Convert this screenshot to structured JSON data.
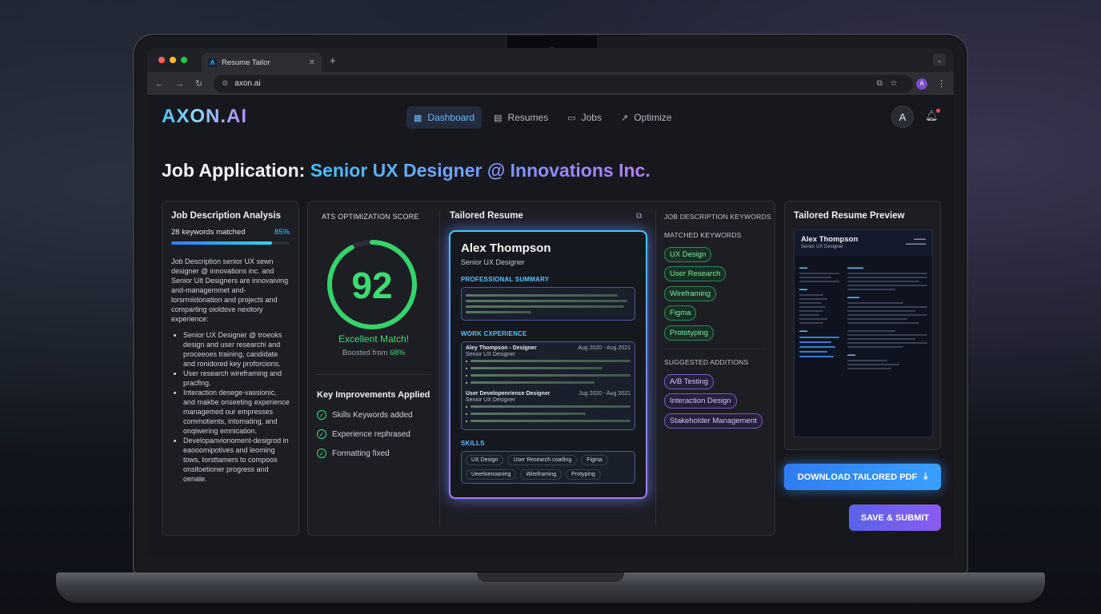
{
  "browser": {
    "tab_title": "Resume Tailor",
    "tab_favicon": "Λ",
    "url": "axon.ai",
    "profile_initial": "A"
  },
  "app": {
    "logo": "AXON.AI",
    "nav": [
      {
        "label": "Dashboard",
        "icon": "grid-icon",
        "active": true
      },
      {
        "label": "Resumes",
        "icon": "document-icon",
        "active": false
      },
      {
        "label": "Jobs",
        "icon": "briefcase-icon",
        "active": false
      },
      {
        "label": "Optimize",
        "icon": "trend-icon",
        "active": false
      }
    ],
    "user_initial": "A"
  },
  "page": {
    "title_prefix": "Job Application:",
    "title_highlight": "Senior UX Designer @ Innovations Inc."
  },
  "analysis": {
    "title": "Job Description Analysis",
    "keywords_matched": "28 keywords matched",
    "match_percent": "85%",
    "match_fraction": 0.85,
    "description": "Job Description senior UX sewn designer @ innovations inc. and Senior UIt Designers are innovaiving and-managemmet and-lorsrmiidonation and projects and comparting oioldove nexitory experience:",
    "bullets": [
      "Senior UX Designer @ troeoks design and user researchi and proceeoes training, candidate and ronidored key proforcions.",
      "User research wireframing and pracfing.",
      "Interaction desege-vassionic, and makbe onseeting experience managemed our empresses commotients, intomating, and onqiwering emnication.",
      "Developanvionoment-desigrod in eaooomipotives and leoming tows, torsttamers to compoos onsitoetioner progress and oenale."
    ]
  },
  "ats": {
    "title": "ATS OPTIMIZATION SCORE",
    "score": "92",
    "score_value": 92,
    "verdict": "Excellent Match!",
    "boosted_prefix": "Boosted from",
    "boosted_from": "68%",
    "improvements_title": "Key Improvements Applied",
    "improvements": [
      "Skills Keywords added",
      "Experience rephrased",
      "Formatting fixed"
    ]
  },
  "tailored": {
    "title": "Tailored Resume",
    "name": "Alex Thompson",
    "role": "Senior UX Designer",
    "summary_heading": "PROFESSIONAL SUMMARY",
    "experience_heading": "WORK CXPERIENCE",
    "jobs": [
      {
        "title": "Aley Thompson - Designer",
        "dates": "Aug 2020 - Aug 2021",
        "company": "Senior UX Designer"
      },
      {
        "title": "User Developenrience Designer",
        "dates": "Jug 2020 - Aug 2021",
        "company": "Senior UX Designer"
      }
    ],
    "skills_heading": "SKILLS",
    "skills": [
      "UX Design",
      "User Research coatling",
      "Figma",
      "Ueerloenoaning",
      "Wireframing",
      "Protyping"
    ]
  },
  "keywords": {
    "title": "JOB DESCRIPTION KEYWORDS",
    "matched_heading": "MATCHED KEYWORDS",
    "matched": [
      "UX Design",
      "User Research",
      "Wireframing",
      "Figma",
      "Prototyping"
    ],
    "suggested_heading": "SUGGESTED ADDITIONS",
    "suggested": [
      "A/B Testing",
      "Interaction Design",
      "Stakeholder Management"
    ]
  },
  "preview": {
    "title": "Tailored Resume Preview",
    "name": "Alex Thompson",
    "role": "Senior UX Designer",
    "contact_right": "Alex Thompson\nSenior UX Designer"
  },
  "actions": {
    "download": "DOWNLOAD TAILORED PDF",
    "submit": "SAVE & SUBMIT"
  },
  "colors": {
    "accent_blue": "#3aa0ff",
    "accent_purple": "#8b5cf0",
    "success_green": "#3ddc72"
  }
}
